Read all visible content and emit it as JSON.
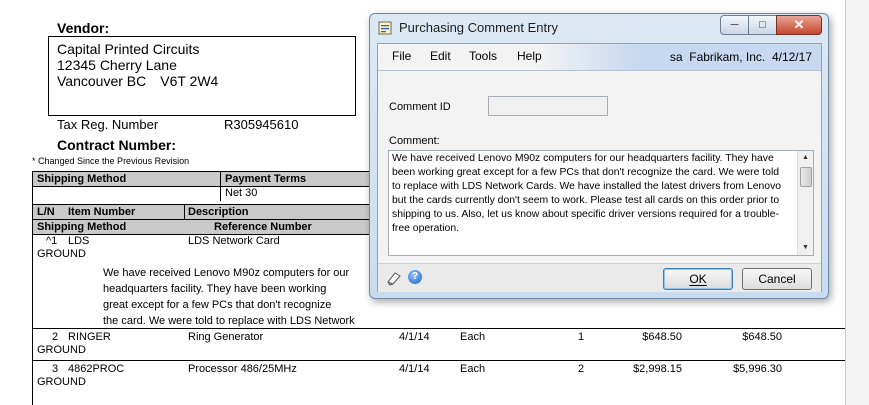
{
  "report": {
    "vendor_label": "Vendor:",
    "vendor_lines": [
      "Capital Printed Circuits",
      "12345 Cherry Lane",
      "Vancouver BC",
      "V6T 2W4"
    ],
    "tax_label": "Tax Reg. Number",
    "tax_value": "R305945610",
    "contract_label": "Contract Number:",
    "changed_note": "*  Changed Since the Previous Revision",
    "headers": {
      "shipping_method": "Shipping Method",
      "payment_terms": "Payment Terms",
      "ln": "L/N",
      "item_number": "Item Number",
      "description": "Description",
      "shipping_method_2": "Shipping Method",
      "reference_number": "Reference Number"
    },
    "payment_terms_value": "Net 30",
    "lines": [
      {
        "ln": "^1",
        "item": "LDS",
        "description": "LDS Network Card",
        "ship": "GROUND",
        "date": "",
        "uom": "",
        "qty": "",
        "price": "",
        "ext": ""
      },
      {
        "ln": "2",
        "item": "RINGER",
        "description": "Ring Generator",
        "ship": "GROUND",
        "date": "4/1/14",
        "uom": "Each",
        "qty": "1",
        "price": "$648.50",
        "ext": "$648.50"
      },
      {
        "ln": "3",
        "item": "4862PROC",
        "description": "Processor 486/25MHz",
        "ship": "GROUND",
        "date": "4/1/14",
        "uom": "Each",
        "qty": "2",
        "price": "$2,998.15",
        "ext": "$5,996.30"
      }
    ],
    "line1_comment": [
      "We have received Lenovo M90z computers for our",
      "headquarters facility. They have been working",
      "great except for a few PCs that don't recognize",
      "the card. We were told to replace with LDS Network"
    ]
  },
  "dialog": {
    "title": "Purchasing Comment Entry",
    "menu": [
      "File",
      "Edit",
      "Tools",
      "Help"
    ],
    "user": "sa",
    "company": "Fabrikam, Inc.",
    "date": "4/12/17",
    "comment_id_label": "Comment ID",
    "comment_id_value": "",
    "comment_label": "Comment:",
    "comment_lines": [
      "We have received Lenovo M90z computers for our headquarters facility. They have",
      "been working great except for a few PCs that don't recognize the card. We were told",
      "to replace with LDS Network Cards. We have installed the latest drivers from Lenovo",
      " but the cards currently don't seem to work. Please test all cards on this order prior to",
      "shipping to us. Also, let us know about specific driver versions required for a trouble-",
      "free operation."
    ],
    "ok_label": "OK",
    "cancel_label": "Cancel",
    "icons": {
      "title": "window-icon",
      "note": "note-icon",
      "help": "help-icon"
    }
  }
}
